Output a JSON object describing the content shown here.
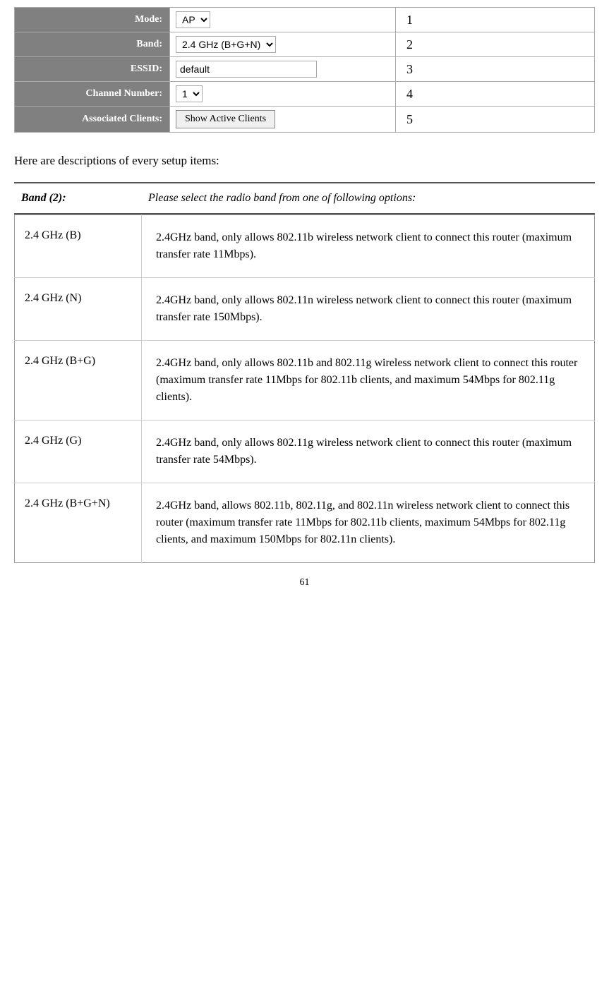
{
  "settings_table": {
    "rows": [
      {
        "label": "Mode:",
        "value_type": "select",
        "select_value": "AP",
        "number": "1"
      },
      {
        "label": "Band:",
        "value_type": "select",
        "select_value": "2.4 GHz (B+G+N)",
        "number": "2"
      },
      {
        "label": "ESSID:",
        "value_type": "text",
        "text_value": "default",
        "number": "3"
      },
      {
        "label": "Channel Number:",
        "value_type": "select",
        "select_value": "1",
        "number": "4"
      },
      {
        "label": "Associated Clients:",
        "value_type": "button",
        "button_label": "Show Active Clients",
        "number": "5"
      }
    ]
  },
  "description_intro": "Here are descriptions of every setup items:",
  "band_header": {
    "label": "Band (2):",
    "description": "Please select the radio band from one of following options:"
  },
  "band_options": [
    {
      "name": "2.4 GHz (B)",
      "description": "2.4GHz band, only allows 802.11b wireless network client to connect this router (maximum transfer rate 11Mbps)."
    },
    {
      "name": "2.4 GHz (N)",
      "description": "2.4GHz band, only allows 802.11n wireless network client to connect this router (maximum transfer rate 150Mbps)."
    },
    {
      "name": "2.4 GHz (B+G)",
      "description": "2.4GHz band, only allows 802.11b and 802.11g wireless network client to connect this router (maximum transfer rate 11Mbps for 802.11b clients, and maximum 54Mbps for 802.11g clients)."
    },
    {
      "name": "2.4 GHz (G)",
      "description": "2.4GHz band, only allows 802.11g wireless network client to connect this router (maximum transfer rate 54Mbps)."
    },
    {
      "name": "2.4 GHz (B+G+N)",
      "description": "2.4GHz band, allows 802.11b, 802.11g, and 802.11n wireless network client to connect this router (maximum transfer rate 11Mbps for 802.11b clients, maximum 54Mbps for 802.11g clients, and maximum 150Mbps for 802.11n clients)."
    }
  ],
  "page_number": "61"
}
